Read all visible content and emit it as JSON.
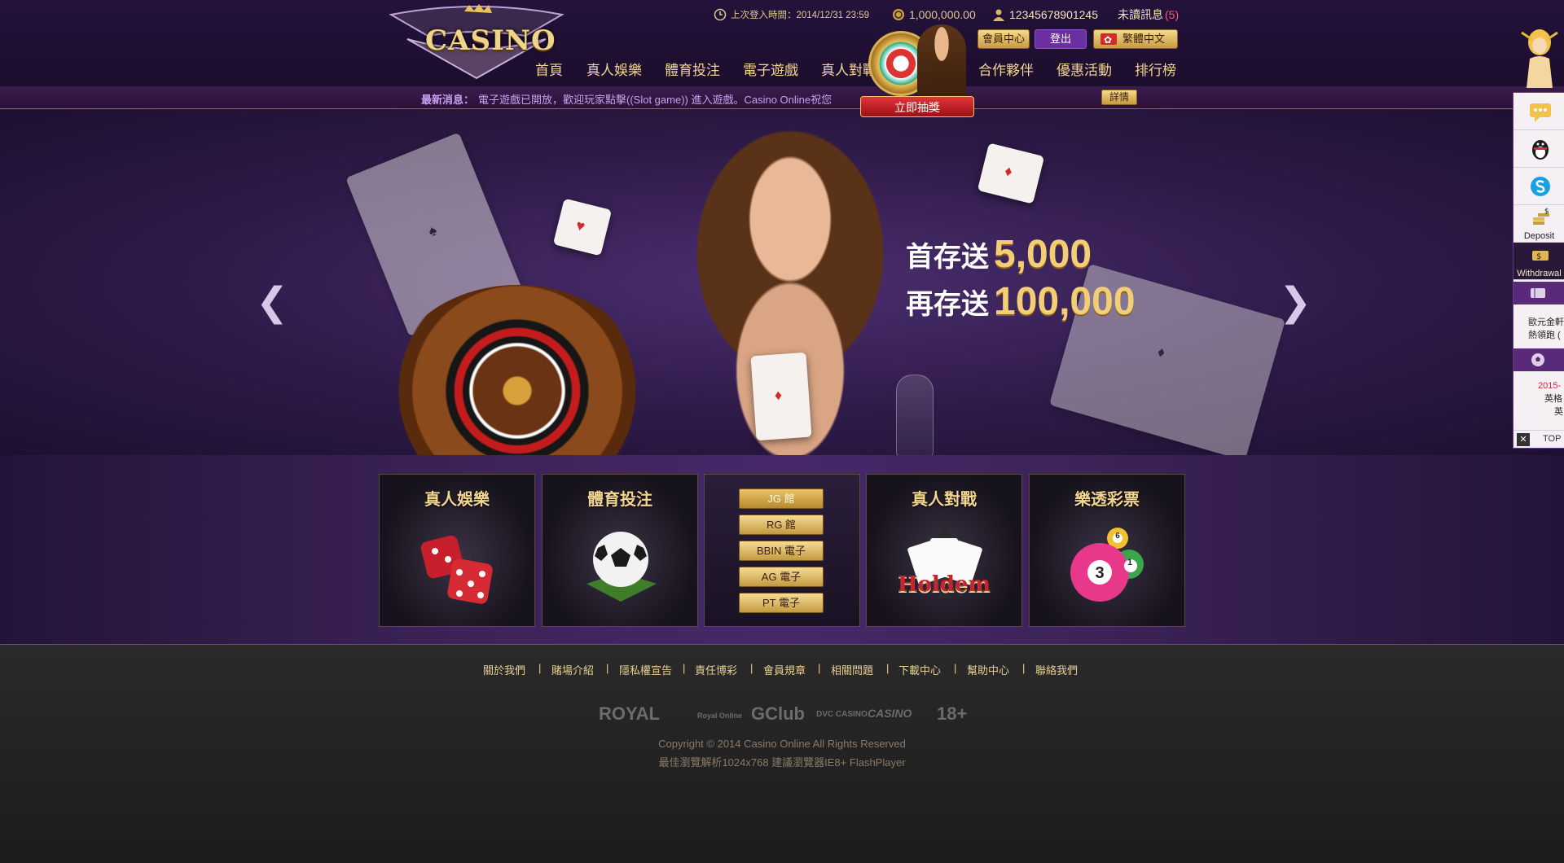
{
  "header": {
    "logo_text": "CASINO",
    "last_login": "上次登入時間：2014/12/31 23:59",
    "balance": "1,000,000.00",
    "account": "12345678901245",
    "unread_label": "未讀訊息",
    "unread_count": "(5)",
    "member_center": "會員中心",
    "logout": "登出",
    "language": "繁體中文",
    "lottery_label": "立即抽獎",
    "nav": [
      "首頁",
      "真人娛樂",
      "體育投注",
      "電子遊戲",
      "真人對戰",
      "合作夥伴",
      "優惠活動",
      "排行榜"
    ]
  },
  "ticker": {
    "label": "最新消息：",
    "message": "電子遊戲已開放，歡迎玩家點擊((Slot game)) 進入遊戲。Casino Online祝您",
    "detail": "詳情"
  },
  "banner": {
    "prev": "❮",
    "next": "❯",
    "line1_prefix": "首存送",
    "line1_amount": "5,000",
    "line2_prefix": "再存送",
    "line2_amount": "100,000"
  },
  "tiles": {
    "live": "真人娛樂",
    "sports": "體育投注",
    "slots": [
      "JG 館",
      "RG 館",
      "BBIN 電子",
      "AG 電子",
      "PT 電子"
    ],
    "battle": "真人對戰",
    "battle_art": "Holdem",
    "lottery": "樂透彩票",
    "balls": [
      "3",
      "6",
      "1"
    ]
  },
  "footer": {
    "links": [
      "關於我們",
      "賭場介紹",
      "隱私權宣告",
      "責任博彩",
      "會員規章",
      "相關問題",
      "下載中心",
      "幫助中心",
      "聯絡我們"
    ],
    "partners": [
      "ROYAL",
      "Royal Online",
      "GClub",
      "DVC CASINO",
      "CASINO",
      "18+"
    ],
    "copyright": "Copyright © 2014 Casino Online All Rights Reserved",
    "browser_note": "最佳瀏覽解析1024x768 建議瀏覽器IE8+ FlashPlayer"
  },
  "dock": {
    "deposit": "Deposit",
    "withdrawal": "Withdrawal",
    "promo_line1": "歐元金軒",
    "promo_line2": "熱領跑 (",
    "news_line1": "2015-",
    "news_line2": "英格",
    "news_line3": "英",
    "top": "TOP"
  },
  "colors": {
    "accent_gold": "#f2cf76",
    "header_purple": "#24123a",
    "ticker_text": "#c9a0ee",
    "unread_red": "#ff5a7a",
    "logout_purple": "#6a2fa0"
  }
}
